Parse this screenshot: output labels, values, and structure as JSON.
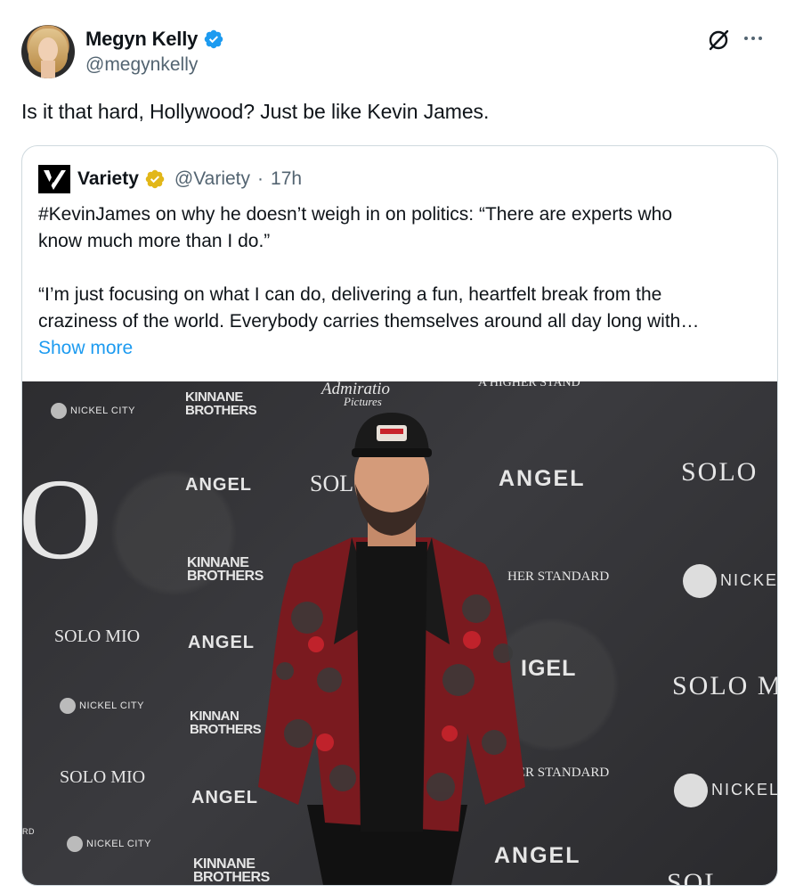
{
  "author": {
    "display_name": "Megyn Kelly",
    "handle": "@megynkelly",
    "verified_color": "#1d9bf0",
    "avatar_icon": "avatar-photo"
  },
  "header_icons": {
    "grok": "grok-icon",
    "more": "more-icon"
  },
  "tweet": {
    "text": "Is it that hard, Hollywood? Just be like Kevin James."
  },
  "quoted": {
    "display_name": "Variety",
    "handle": "@Variety",
    "separator": "·",
    "time": "17h",
    "badge_color": "#e2b719",
    "line1": "#KevinJames on why he doesn’t weigh in on politics: “There are experts who",
    "line2": "know much more than I do.”",
    "line3": "“I’m just focusing on what I can do, delivering a fun, heartfelt break from the",
    "line4": "craziness of the world. Everybody carries themselves around all day long with…",
    "show_more": "Show more"
  },
  "photo": {
    "backdrop": {
      "nickel_city": "NICKEL CITY",
      "kinnane_1": "KINNANE",
      "kinnane_2": "BROTHERS",
      "admiratio_1": "Admiratio",
      "admiratio_2": "Pictures",
      "higher_standard_top": "A HIGHER STAND",
      "angel": "ANGEL",
      "solo": "SOLO",
      "solo_mio": "SOLO MIO",
      "sol": "SOL",
      "big_o": "O",
      "her_standard": "HER STANDARD",
      "nicke": "NICKE",
      "nickel": "NICKEL",
      "solo_m": "SOLO M",
      "igel": "IGEL",
      "kinnan": "KINNAN",
      "brothers_cut": "BROTHERS",
      "rd": "RD",
      "solo_cut": "SOL"
    }
  }
}
